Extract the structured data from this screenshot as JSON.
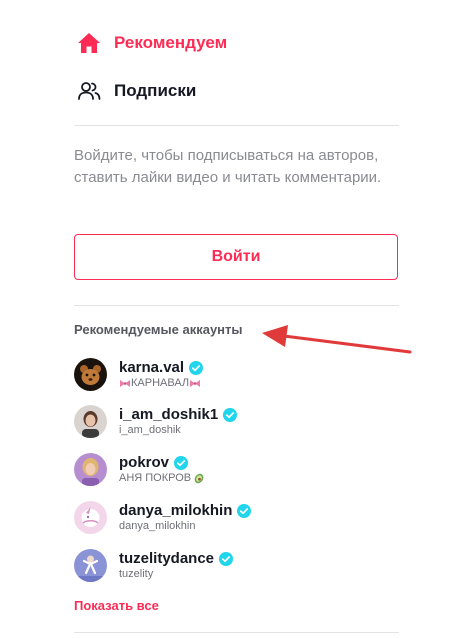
{
  "nav": {
    "recommended_label": "Рекомендуем",
    "subscriptions_label": "Подписки"
  },
  "login_prompt": "Войдите, чтобы подписываться на авторов, ставить лайки видео и читать комментарии.",
  "login_button": "Войти",
  "section_title": "Рекомендуемые аккаунты",
  "accounts": [
    {
      "username": "karna.val",
      "nickname": "КАРНАВАЛ",
      "verified": true
    },
    {
      "username": "i_am_doshik1",
      "nickname": "i_am_doshik",
      "verified": true
    },
    {
      "username": "pokrov",
      "nickname": "АНЯ ПОКРОВ",
      "verified": true
    },
    {
      "username": "danya_milokhin",
      "nickname": "danya_milokhin",
      "verified": true
    },
    {
      "username": "tuzelitydance",
      "nickname": "tuzelity",
      "verified": true
    }
  ],
  "show_all": "Показать все",
  "colors": {
    "accent": "#fe2c55",
    "verified": "#20d5ec",
    "annotation_arrow": "#e03a3a"
  },
  "icons": [
    "home-icon",
    "users-icon",
    "verified-icon",
    "arrow-annotation"
  ]
}
